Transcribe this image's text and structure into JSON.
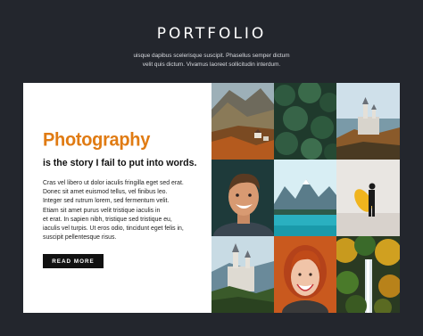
{
  "section": {
    "title": "PORTFOLIO",
    "subtitle_line1": "uisque dapibus scelerisque suscipit. Phasellus semper dictum",
    "subtitle_line2": "velit quis dictum. Vivamus laoreet sollicitudin interdum."
  },
  "card": {
    "heading": "Photography",
    "tagline": "is the story I fail to put into words.",
    "body_lines": [
      "Cras vel libero ut dolor iaculis fringilla eget sed erat.",
      "Donec sit amet euismod tellus, vel finibus leo.",
      "Integer sed rutrum lorem, sed fermentum velit.",
      "Etiam sit amet purus velit tristique iaculis in",
      "et erat. In sapien nibh, tristique sed tristique eu,",
      "iaculis vel turpis. Ut eros odio, tincidunt eget felis in,",
      "suscipit pellentesque risus."
    ],
    "button_label": "READ MORE"
  },
  "gallery": [
    {
      "name": "photo-mountain-village",
      "subject": "mountain village"
    },
    {
      "name": "photo-pine-forest-aerial",
      "subject": "pine forest aerial"
    },
    {
      "name": "photo-castle-hilltop",
      "subject": "castle on hilltop"
    },
    {
      "name": "photo-smiling-man",
      "subject": "smiling man portrait"
    },
    {
      "name": "photo-mountain-lake",
      "subject": "turquoise mountain lake"
    },
    {
      "name": "photo-surfer-beach",
      "subject": "surfer on beach"
    },
    {
      "name": "photo-castle-forest",
      "subject": "castle in forest"
    },
    {
      "name": "photo-smiling-woman",
      "subject": "smiling red-haired woman"
    },
    {
      "name": "photo-autumn-waterfall",
      "subject": "autumn forest waterfall"
    }
  ]
}
